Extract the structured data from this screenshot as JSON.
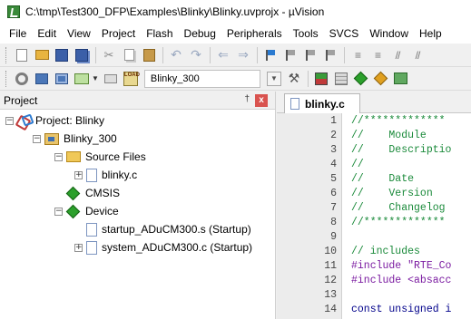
{
  "window": {
    "title": "C:\\tmp\\Test300_DFP\\Examples\\Blinky\\Blinky.uvprojx - µVision"
  },
  "menu": [
    "File",
    "Edit",
    "View",
    "Project",
    "Flash",
    "Debug",
    "Peripherals",
    "Tools",
    "SVCS",
    "Window",
    "Help"
  ],
  "toolbar": {
    "target_name": "Blinky_300",
    "load_label": "LOAD"
  },
  "project_panel": {
    "title": "Project",
    "pin_glyph": "†",
    "close_glyph": "x",
    "tree": [
      {
        "label": "Project: Blinky",
        "expander": "−",
        "icon": "project-icon"
      },
      {
        "label": "Blinky_300",
        "expander": "−",
        "icon": "target-icon"
      },
      {
        "label": "Source Files",
        "expander": "−",
        "icon": "folder-icon"
      },
      {
        "label": "blinky.c",
        "expander": "+",
        "icon": "c-file-icon"
      },
      {
        "label": "CMSIS",
        "expander": "",
        "icon": "component-icon"
      },
      {
        "label": "Device",
        "expander": "−",
        "icon": "component-icon"
      },
      {
        "label": "startup_ADuCM300.s (Startup)",
        "expander": "",
        "icon": "asm-file-icon"
      },
      {
        "label": "system_ADuCM300.c (Startup)",
        "expander": "+",
        "icon": "c-file-icon"
      }
    ]
  },
  "editor": {
    "tab_label": "blinky.c",
    "lines": [
      {
        "n": "1",
        "text": "//*************"
      },
      {
        "n": "2",
        "text": "//    Module"
      },
      {
        "n": "3",
        "text": "//    Descriptio"
      },
      {
        "n": "4",
        "text": "//"
      },
      {
        "n": "5",
        "text": "//    Date"
      },
      {
        "n": "6",
        "text": "//    Version"
      },
      {
        "n": "7",
        "text": "//    Changelog"
      },
      {
        "n": "8",
        "text": "//*************"
      },
      {
        "n": "9",
        "text": ""
      },
      {
        "n": "10",
        "text": "// includes"
      },
      {
        "n": "11",
        "text": "#include \"RTE_Co"
      },
      {
        "n": "12",
        "text": "#include <absacc"
      },
      {
        "n": "13",
        "text": ""
      },
      {
        "n": "14",
        "text": "const unsigned i"
      }
    ]
  },
  "colors": {
    "comment": "#1a8a3a",
    "directive": "#7a1aa0",
    "string": "#b01010",
    "keyword": "#00008a"
  }
}
